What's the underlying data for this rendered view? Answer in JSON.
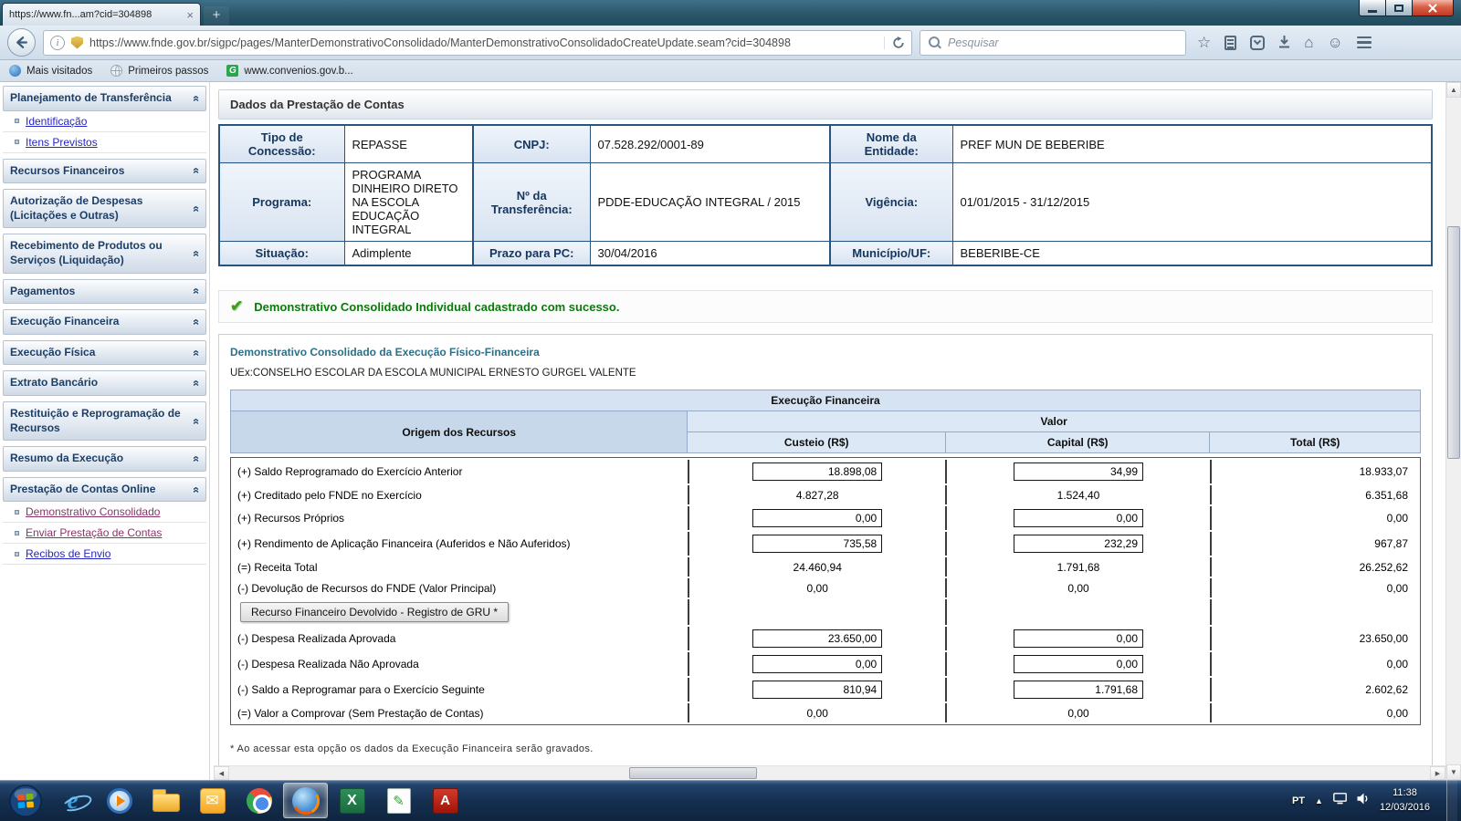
{
  "browser": {
    "tab_title": "https://www.fn...am?cid=304898",
    "url": "https://www.fnde.gov.br/sigpc/pages/ManterDemonstrativoConsolidado/ManterDemonstrativoConsolidadoCreateUpdate.seam?cid=304898",
    "search_placeholder": "Pesquisar",
    "bookmarks": [
      {
        "label": "Mais visitados"
      },
      {
        "label": "Primeiros passos"
      },
      {
        "label": "www.convenios.gov.b..."
      }
    ]
  },
  "icons": {
    "collapse_chevron": "«",
    "check": "✔",
    "star": "☆",
    "home": "⌂",
    "smiley": "☺",
    "mail": "✉",
    "pencil": "✎",
    "scroll_up": "▲",
    "scroll_down": "▼",
    "scroll_left": "◀",
    "scroll_right": "▶",
    "tray_expand": "▲",
    "info": "i",
    "ie": "e",
    "excel": "X",
    "pdf": "A",
    "g_favicon": "G",
    "tab_close": "×",
    "new_tab": "+"
  },
  "sidebar": {
    "sections": [
      {
        "label": "Planejamento de Transferência",
        "links": [
          {
            "label": "Identificação"
          },
          {
            "label": "Itens Previstos"
          }
        ]
      },
      {
        "label": "Recursos Financeiros",
        "links": []
      },
      {
        "label": "Autorização de Despesas (Licitações e Outras)",
        "links": []
      },
      {
        "label": "Recebimento de Produtos ou Serviços (Liquidação)",
        "links": []
      },
      {
        "label": "Pagamentos",
        "links": []
      },
      {
        "label": "Execução Financeira",
        "links": []
      },
      {
        "label": "Execução Física",
        "links": []
      },
      {
        "label": "Extrato Bancário",
        "links": []
      },
      {
        "label": "Restituição e Reprogramação de Recursos",
        "links": []
      },
      {
        "label": "Resumo da Execução",
        "links": []
      },
      {
        "label": "Prestação de Contas Online",
        "links": [
          {
            "label": "Demonstrativo Consolidado"
          },
          {
            "label": "Enviar Prestação de Contas"
          },
          {
            "label": "Recibos de Envio"
          }
        ]
      }
    ]
  },
  "main": {
    "page_title": "Dados da Prestação de Contas",
    "info_rows": [
      [
        {
          "label": "Tipo de Concessão:",
          "value": "REPASSE"
        },
        {
          "label": "CNPJ:",
          "value": "07.528.292/0001-89"
        },
        {
          "label": "Nome da Entidade:",
          "value": "PREF MUN DE BEBERIBE"
        }
      ],
      [
        {
          "label": "Programa:",
          "value": "PROGRAMA DINHEIRO DIRETO NA ESCOLA EDUCAÇÃO INTEGRAL"
        },
        {
          "label": "Nº da Transferência:",
          "value": "PDDE-EDUCAÇÃO INTEGRAL / 2015"
        },
        {
          "label": "Vigência:",
          "value": "01/01/2015 - 31/12/2015"
        }
      ],
      [
        {
          "label": "Situação:",
          "value": "Adimplente"
        },
        {
          "label": "Prazo para PC:",
          "value": "30/04/2016"
        },
        {
          "label": "Município/UF:",
          "value": "BEBERIBE-CE"
        }
      ]
    ],
    "success_message": "Demonstrativo Consolidado Individual cadastrado com sucesso.",
    "section_title": "Demonstrativo Consolidado da Execução Físico-Financeira",
    "uex": "UEx:CONSELHO ESCOLAR DA ESCOLA MUNICIPAL ERNESTO GURGEL VALENTE",
    "table": {
      "title": "Execução Financeira",
      "col_origem": "Origem dos Recursos",
      "col_valor": "Valor",
      "col_custeio": "Custeio (R$)",
      "col_capital": "Capital (R$)",
      "col_total": "Total (R$)",
      "rows": [
        {
          "label": "(+) Saldo Reprogramado do Exercício Anterior",
          "custeio": "18.898,08",
          "capital": "34,99",
          "total": "18.933,07"
        },
        {
          "label": "(+) Creditado pelo FNDE no Exercício",
          "custeio": "4.827,28",
          "capital": "1.524,40",
          "total": "6.351,68"
        },
        {
          "label": "(+) Recursos Próprios",
          "custeio": "0,00",
          "capital": "0,00",
          "total": "0,00"
        },
        {
          "label": "(+) Rendimento de Aplicação Financeira (Auferidos e Não Auferidos)",
          "custeio": "735,58",
          "capital": "232,29",
          "total": "967,87"
        },
        {
          "label": "(=) Receita Total",
          "custeio": "24.460,94",
          "capital": "1.791,68",
          "total": "26.252,62"
        },
        {
          "label": "(-) Devolução de Recursos do FNDE (Valor Principal)",
          "custeio": "0,00",
          "capital": "0,00",
          "total": "0,00"
        },
        {
          "label": "Recurso Financeiro Devolvido - Registro de GRU *"
        },
        {
          "label": "(-) Despesa Realizada Aprovada",
          "custeio": "23.650,00",
          "capital": "0,00",
          "total": "23.650,00"
        },
        {
          "label": "(-) Despesa Realizada Não Aprovada",
          "custeio": "0,00",
          "capital": "0,00",
          "total": "0,00"
        },
        {
          "label": "(-) Saldo a Reprogramar para o Exercício Seguinte",
          "custeio": "810,94",
          "capital": "1.791,68",
          "total": "2.602,62"
        },
        {
          "label": "(=) Valor a Comprovar (Sem Prestação de Contas)",
          "custeio": "0,00",
          "capital": "0,00",
          "total": "0,00"
        }
      ]
    },
    "footnote": "* Ao acessar esta opção os dados da Execução Financeira serão gravados."
  },
  "taskbar": {
    "language": "PT",
    "time": "11:38",
    "date": "12/03/2016"
  }
}
